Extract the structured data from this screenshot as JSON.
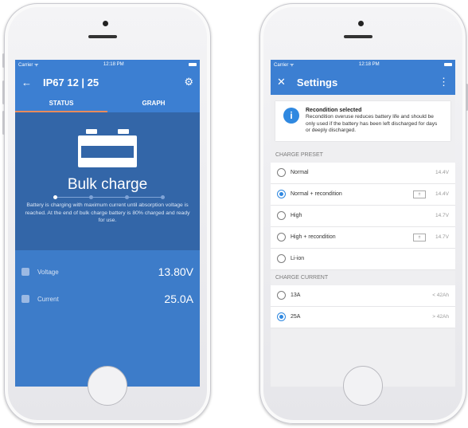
{
  "left_phone": {
    "statusbar": {
      "carrier": "Carrier ᯤ",
      "time": "12:18 PM"
    },
    "appbar": {
      "back_icon": "arrow-left-icon",
      "title": "IP67 12 | 25",
      "settings_icon": "gear-icon"
    },
    "tabs": [
      {
        "label": "STATUS"
      },
      {
        "label": "GRAPH"
      }
    ],
    "status": {
      "state": "Bulk charge",
      "description": "Battery is charging with maximum current until absorption voltage is reached. At the end of bulk charge battery is  80% charged and ready for use.",
      "step_count": 4,
      "active_step": 1
    },
    "readings": [
      {
        "label": "Voltage",
        "value": "13.80V"
      },
      {
        "label": "Current",
        "value": "25.0A"
      }
    ]
  },
  "right_phone": {
    "statusbar": {
      "carrier": "Carrier ᯤ",
      "time": "12:18 PM"
    },
    "appbar": {
      "close_icon": "close-icon",
      "title": "Settings",
      "menu_icon": "more-vertical-icon"
    },
    "alert": {
      "title": "Recondition selected",
      "body": "Recondition overuse reduces battery life and should be only used if the battery has been left discharged for days or deeply discharged."
    },
    "charge_preset": {
      "header": "CHARGE PRESET",
      "options": [
        {
          "label": "Normal",
          "value": "14.4V",
          "selected": false,
          "battery_icon": false
        },
        {
          "label": "Normal + recondition",
          "value": "14.4V",
          "selected": true,
          "battery_icon": true
        },
        {
          "label": "High",
          "value": "14.7V",
          "selected": false,
          "battery_icon": false
        },
        {
          "label": "High  + recondition",
          "value": "14.7V",
          "selected": false,
          "battery_icon": true
        },
        {
          "label": "Li-ion",
          "value": "",
          "selected": false,
          "battery_icon": false
        }
      ]
    },
    "charge_current": {
      "header": "CHARGE CURRENT",
      "options": [
        {
          "label": "13A",
          "value": "< 42Ah",
          "selected": false
        },
        {
          "label": "25A",
          "value": "> 42Ah",
          "selected": true
        }
      ]
    }
  },
  "colors": {
    "primary": "#3c7fd2",
    "hero": "#3366a8",
    "screen_bg": "#3d7cc9",
    "tab_indicator": "#e98b5c",
    "radio_selected": "#2f88e0"
  }
}
